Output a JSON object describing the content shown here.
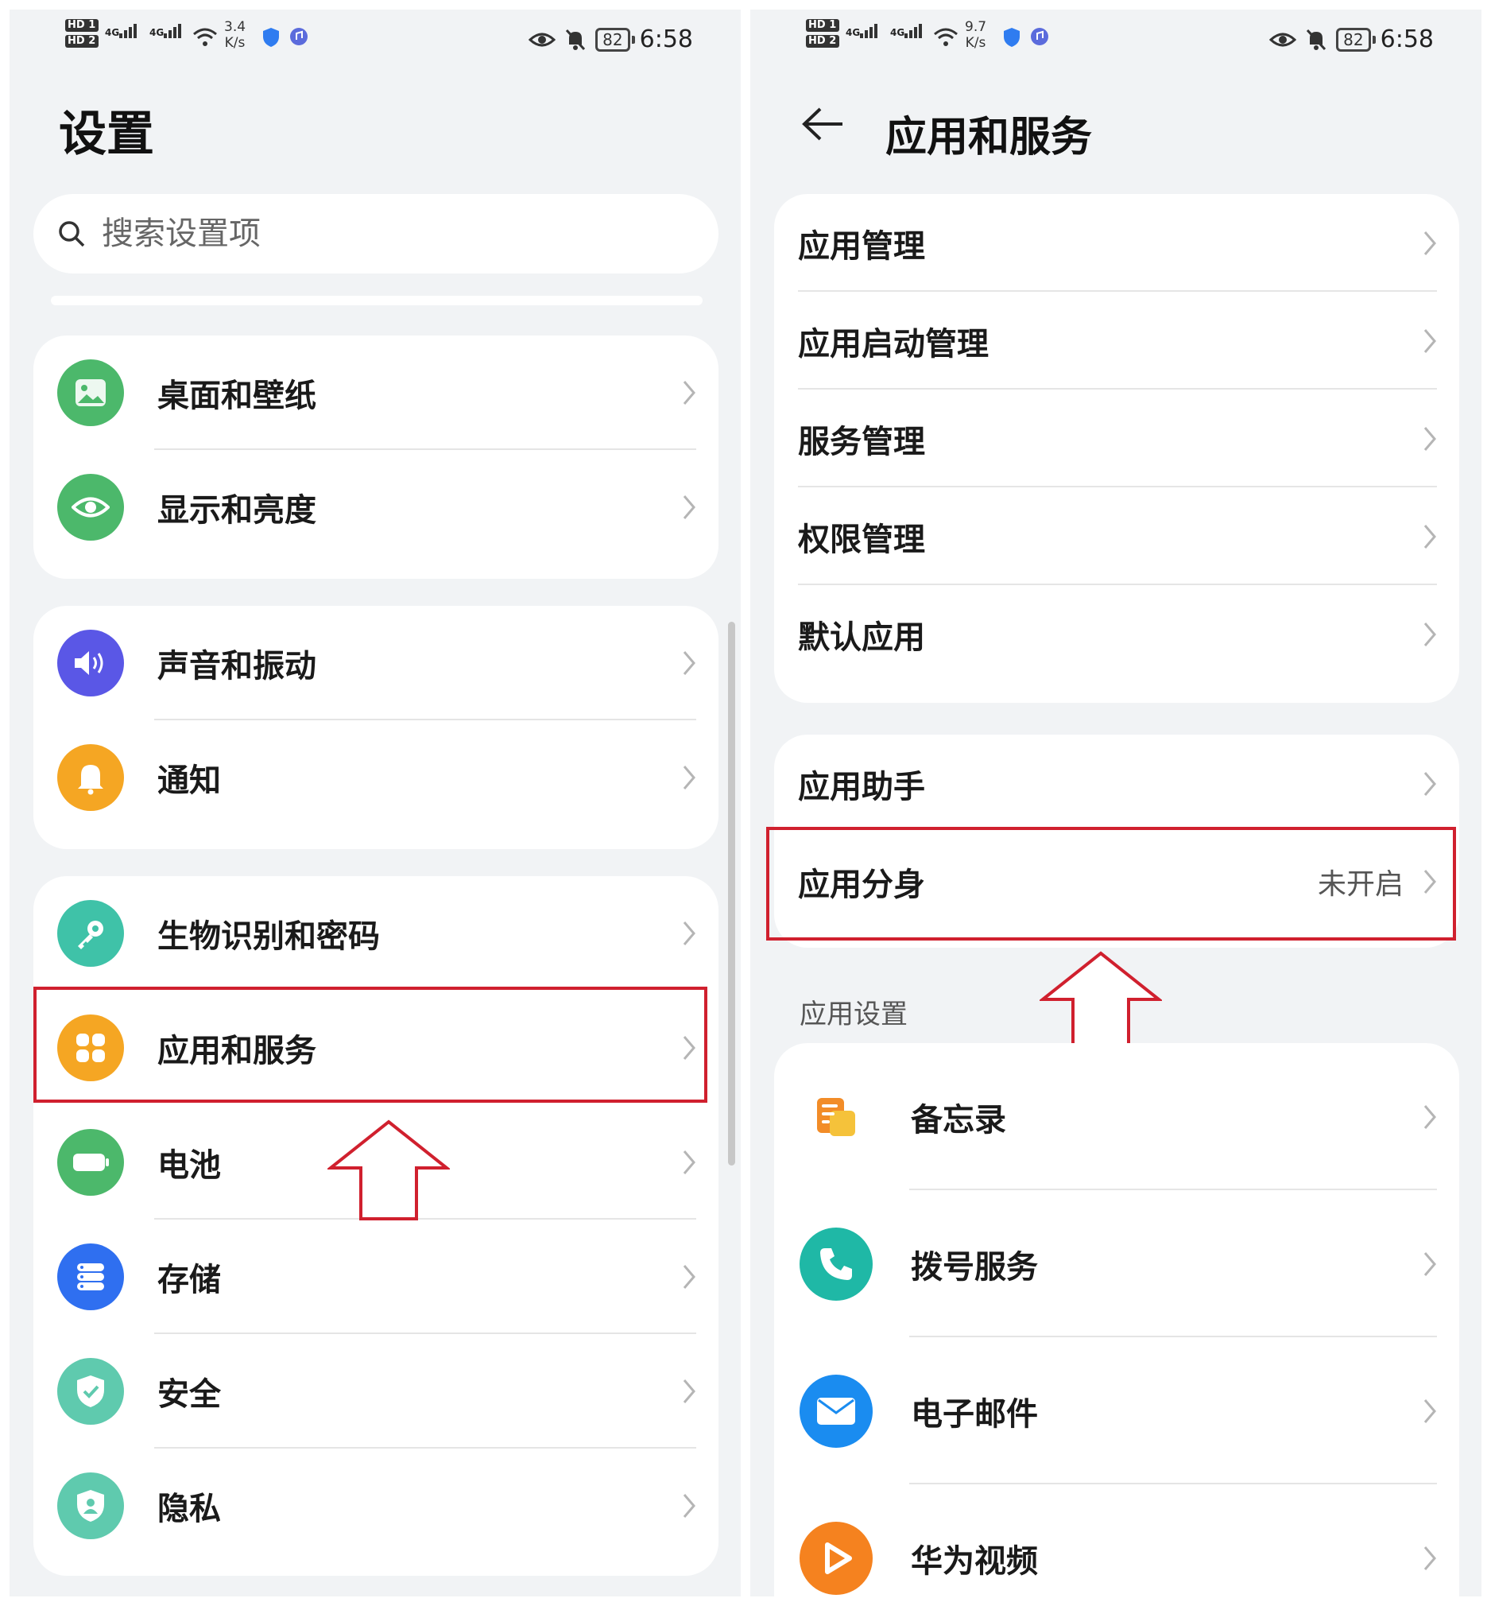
{
  "status_bar": {
    "left_screen_speed": "3.4",
    "right_screen_speed": "9.7",
    "speed_unit": "K/s",
    "network_1": "4G",
    "network_2": "4G",
    "hd_1": "HD 1",
    "hd_2": "HD 2",
    "battery": "82",
    "time": "6:58"
  },
  "settings_screen": {
    "title": "设置",
    "search_placeholder": "搜索设置项",
    "groups": [
      {
        "items": [
          {
            "label": "桌面和壁纸",
            "icon": "wallpaper-icon",
            "color": "#4cb86b"
          },
          {
            "label": "显示和亮度",
            "icon": "eye-icon",
            "color": "#4cb86b"
          }
        ]
      },
      {
        "items": [
          {
            "label": "声音和振动",
            "icon": "speaker-icon",
            "color": "#5a57e6"
          },
          {
            "label": "通知",
            "icon": "bell-icon",
            "color": "#f5a623"
          }
        ]
      },
      {
        "items": [
          {
            "label": "生物识别和密码",
            "icon": "key-icon",
            "color": "#3fc2a8"
          },
          {
            "label": "应用和服务",
            "icon": "apps-icon",
            "color": "#f5a623"
          },
          {
            "label": "电池",
            "icon": "battery-icon",
            "color": "#4cb86b"
          },
          {
            "label": "存储",
            "icon": "storage-icon",
            "color": "#2f6ff0"
          },
          {
            "label": "安全",
            "icon": "shield-check-icon",
            "color": "#5fcaae"
          },
          {
            "label": "隐私",
            "icon": "privacy-icon",
            "color": "#5fcaae"
          }
        ]
      }
    ]
  },
  "apps_screen": {
    "title": "应用和服务",
    "group1": [
      "应用管理",
      "应用启动管理",
      "服务管理",
      "权限管理",
      "默认应用"
    ],
    "group2": [
      {
        "label": "应用助手",
        "value": ""
      },
      {
        "label": "应用分身",
        "value": "未开启"
      }
    ],
    "section_title": "应用设置",
    "apps": [
      {
        "label": "备忘录",
        "icon": "notepad-icon",
        "color": "#f28c28"
      },
      {
        "label": "拨号服务",
        "icon": "phone-icon",
        "color": "#1fb8a6"
      },
      {
        "label": "电子邮件",
        "icon": "mail-icon",
        "color": "#1a8cf0"
      },
      {
        "label": "华为视频",
        "icon": "video-play-icon",
        "color": "#f5821f"
      }
    ]
  },
  "colors": {
    "highlight": "#d0202e",
    "background": "#f1f3f5",
    "card": "#ffffff"
  }
}
